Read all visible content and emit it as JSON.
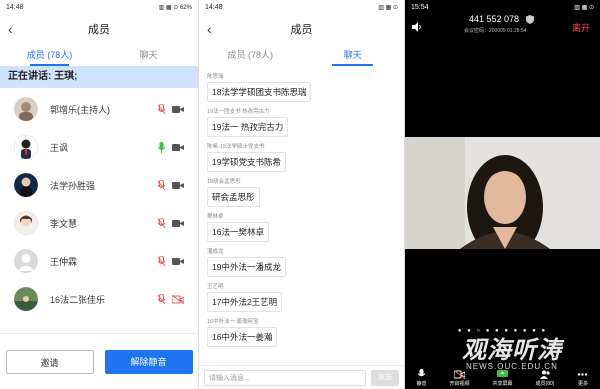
{
  "panel_members": {
    "status_time": "14:48",
    "status_signal": "ull ull ull",
    "status_hd": "HD",
    "status_battery": "62",
    "title": "成员",
    "tab_members": "成员 (78人)",
    "tab_chat": "聊天",
    "speaking": "正在讲话: 王琪;",
    "members": [
      {
        "name": "郭增乐(主持人)",
        "mic": "muted",
        "cam": "on"
      },
      {
        "name": "王讽",
        "mic": "active",
        "cam": "on"
      },
      {
        "name": "法学孙胜强",
        "mic": "muted",
        "cam": "on"
      },
      {
        "name": "李文慧",
        "mic": "muted",
        "cam": "on"
      },
      {
        "name": "王仲霖",
        "mic": "muted",
        "cam": "on"
      },
      {
        "name": "16法二张佳乐",
        "mic": "muted",
        "cam": "off"
      }
    ],
    "invite": "邀请",
    "unmute": "解除静音"
  },
  "panel_chat": {
    "status_time": "14:48",
    "title": "成员",
    "tab_members": "成员 (78人)",
    "tab_chat": "聊天",
    "messages": [
      {
        "sender": "陈思瑞",
        "text": "18法学学硕团支书陈思瑞"
      },
      {
        "sender": "19法一团支书 热孜完古力",
        "text": "19法一 热孜完古力"
      },
      {
        "sender": "陈希-19法学硕士党支书",
        "text": "19学硕党支书陈希"
      },
      {
        "sender": "18研会孟思彤",
        "text": "研会孟思彤"
      },
      {
        "sender": "樊林卓",
        "text": "16法一樊林卓"
      },
      {
        "sender": "潘成龙",
        "text": "19中外法一潘成龙"
      },
      {
        "sender": "王艺明",
        "text": "17中外法2王艺明"
      },
      {
        "sender": "16中外法一 姜瀚宪宝",
        "text": "16中外法一姜瀚"
      }
    ],
    "input_placeholder": "请输入消息...",
    "send": "发送"
  },
  "panel_meeting": {
    "status_time": "15:54",
    "meeting_id": "441 552 078",
    "meeting_sub": "会议密码：200005   01:28:54",
    "leave": "离开",
    "toolbar": [
      {
        "label": "静音",
        "icon": "mic-icon"
      },
      {
        "label": "开启视频",
        "icon": "video-off-icon"
      },
      {
        "label": "共享屏幕",
        "icon": "share-screen-icon"
      },
      {
        "label": "成员(80)",
        "icon": "members-icon"
      },
      {
        "label": "更多",
        "icon": "more-icon"
      }
    ],
    "page_dots": "● ● ○ ● ● ● ● ● ● ●"
  },
  "watermark": "观海听涛",
  "watermark_url": "NEWS.OUC.EDU.CN",
  "colors": {
    "accent": "#1f74f0",
    "leave": "#ff4a4a",
    "speaking_bg": "#cfe3ff"
  }
}
